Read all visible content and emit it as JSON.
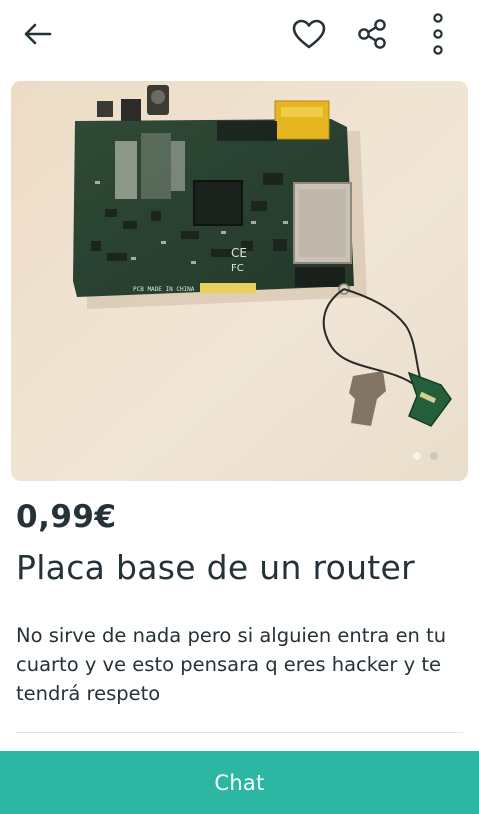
{
  "header": {
    "back_icon": "arrow-left-icon",
    "favorite_icon": "heart-outline-icon",
    "share_icon": "share-icon",
    "more_icon": "more-vertical-icon"
  },
  "product": {
    "image_subject": "green router circuit board with antenna on beige fabric",
    "photo_count": 2,
    "active_photo_index": 0,
    "price": "0,99€",
    "title": "Placa base de un router",
    "description": "No sirve de nada pero si alguien entra en tu cuarto y ve esto pensara q eres hacker y te tendrá respeto"
  },
  "actions": {
    "chat_label": "Chat"
  },
  "colors": {
    "text": "#253238",
    "accent": "#2bb7a2",
    "background": "#ffffff"
  }
}
